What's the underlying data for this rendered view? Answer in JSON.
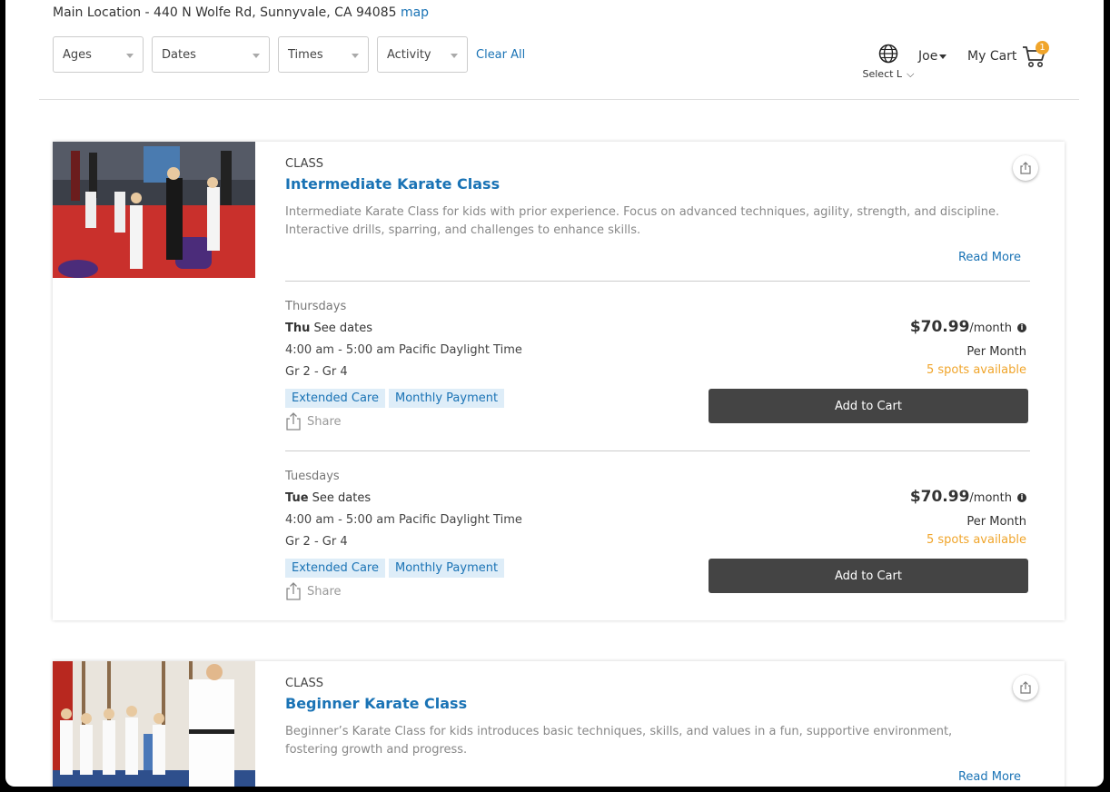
{
  "location": {
    "text": "Main Location - 440 N Wolfe Rd, Sunnyvale, CA 94085",
    "map_link": "map"
  },
  "filters": {
    "ages": "Ages",
    "dates": "Dates",
    "times": "Times",
    "activity": "Activity",
    "clear": "Clear All"
  },
  "header": {
    "language_label": "Select L",
    "user": "Joe",
    "cart_label": "My Cart",
    "cart_count": "1"
  },
  "colors": {
    "link": "#1a73b5",
    "button": "#444444",
    "spots": "#f0a52b",
    "tag_bg": "#deedf8"
  },
  "classes": [
    {
      "type": "CLASS",
      "title": "Intermediate Karate Class",
      "description": "Intermediate Karate Class for kids with prior experience. Focus on advanced techniques, agility, strength, and discipline. Interactive drills, sparring, and challenges to enhance skills.",
      "read_more": "Read More",
      "sessions": [
        {
          "day": "Thursdays",
          "day_short": "Thu",
          "dates_label": "See dates",
          "time": "4:00 am - 5:00 am Pacific Daylight Time",
          "grades": "Gr 2 - Gr 4",
          "tags": [
            "Extended Care",
            "Monthly Payment"
          ],
          "share": "Share",
          "price": "$70.99",
          "price_unit": "/month",
          "per": "Per Month",
          "spots": "5 spots available",
          "button": "Add to Cart"
        },
        {
          "day": "Tuesdays",
          "day_short": "Tue",
          "dates_label": "See dates",
          "time": "4:00 am - 5:00 am Pacific Daylight Time",
          "grades": "Gr 2 - Gr 4",
          "tags": [
            "Extended Care",
            "Monthly Payment"
          ],
          "share": "Share",
          "price": "$70.99",
          "price_unit": "/month",
          "per": "Per Month",
          "spots": "5 spots available",
          "button": "Add to Cart"
        }
      ]
    },
    {
      "type": "CLASS",
      "title": "Beginner Karate Class",
      "description": "Beginner’s Karate Class for kids introduces basic techniques, skills, and values in a fun, supportive environment, fostering growth and progress.",
      "read_more": "Read More"
    }
  ]
}
